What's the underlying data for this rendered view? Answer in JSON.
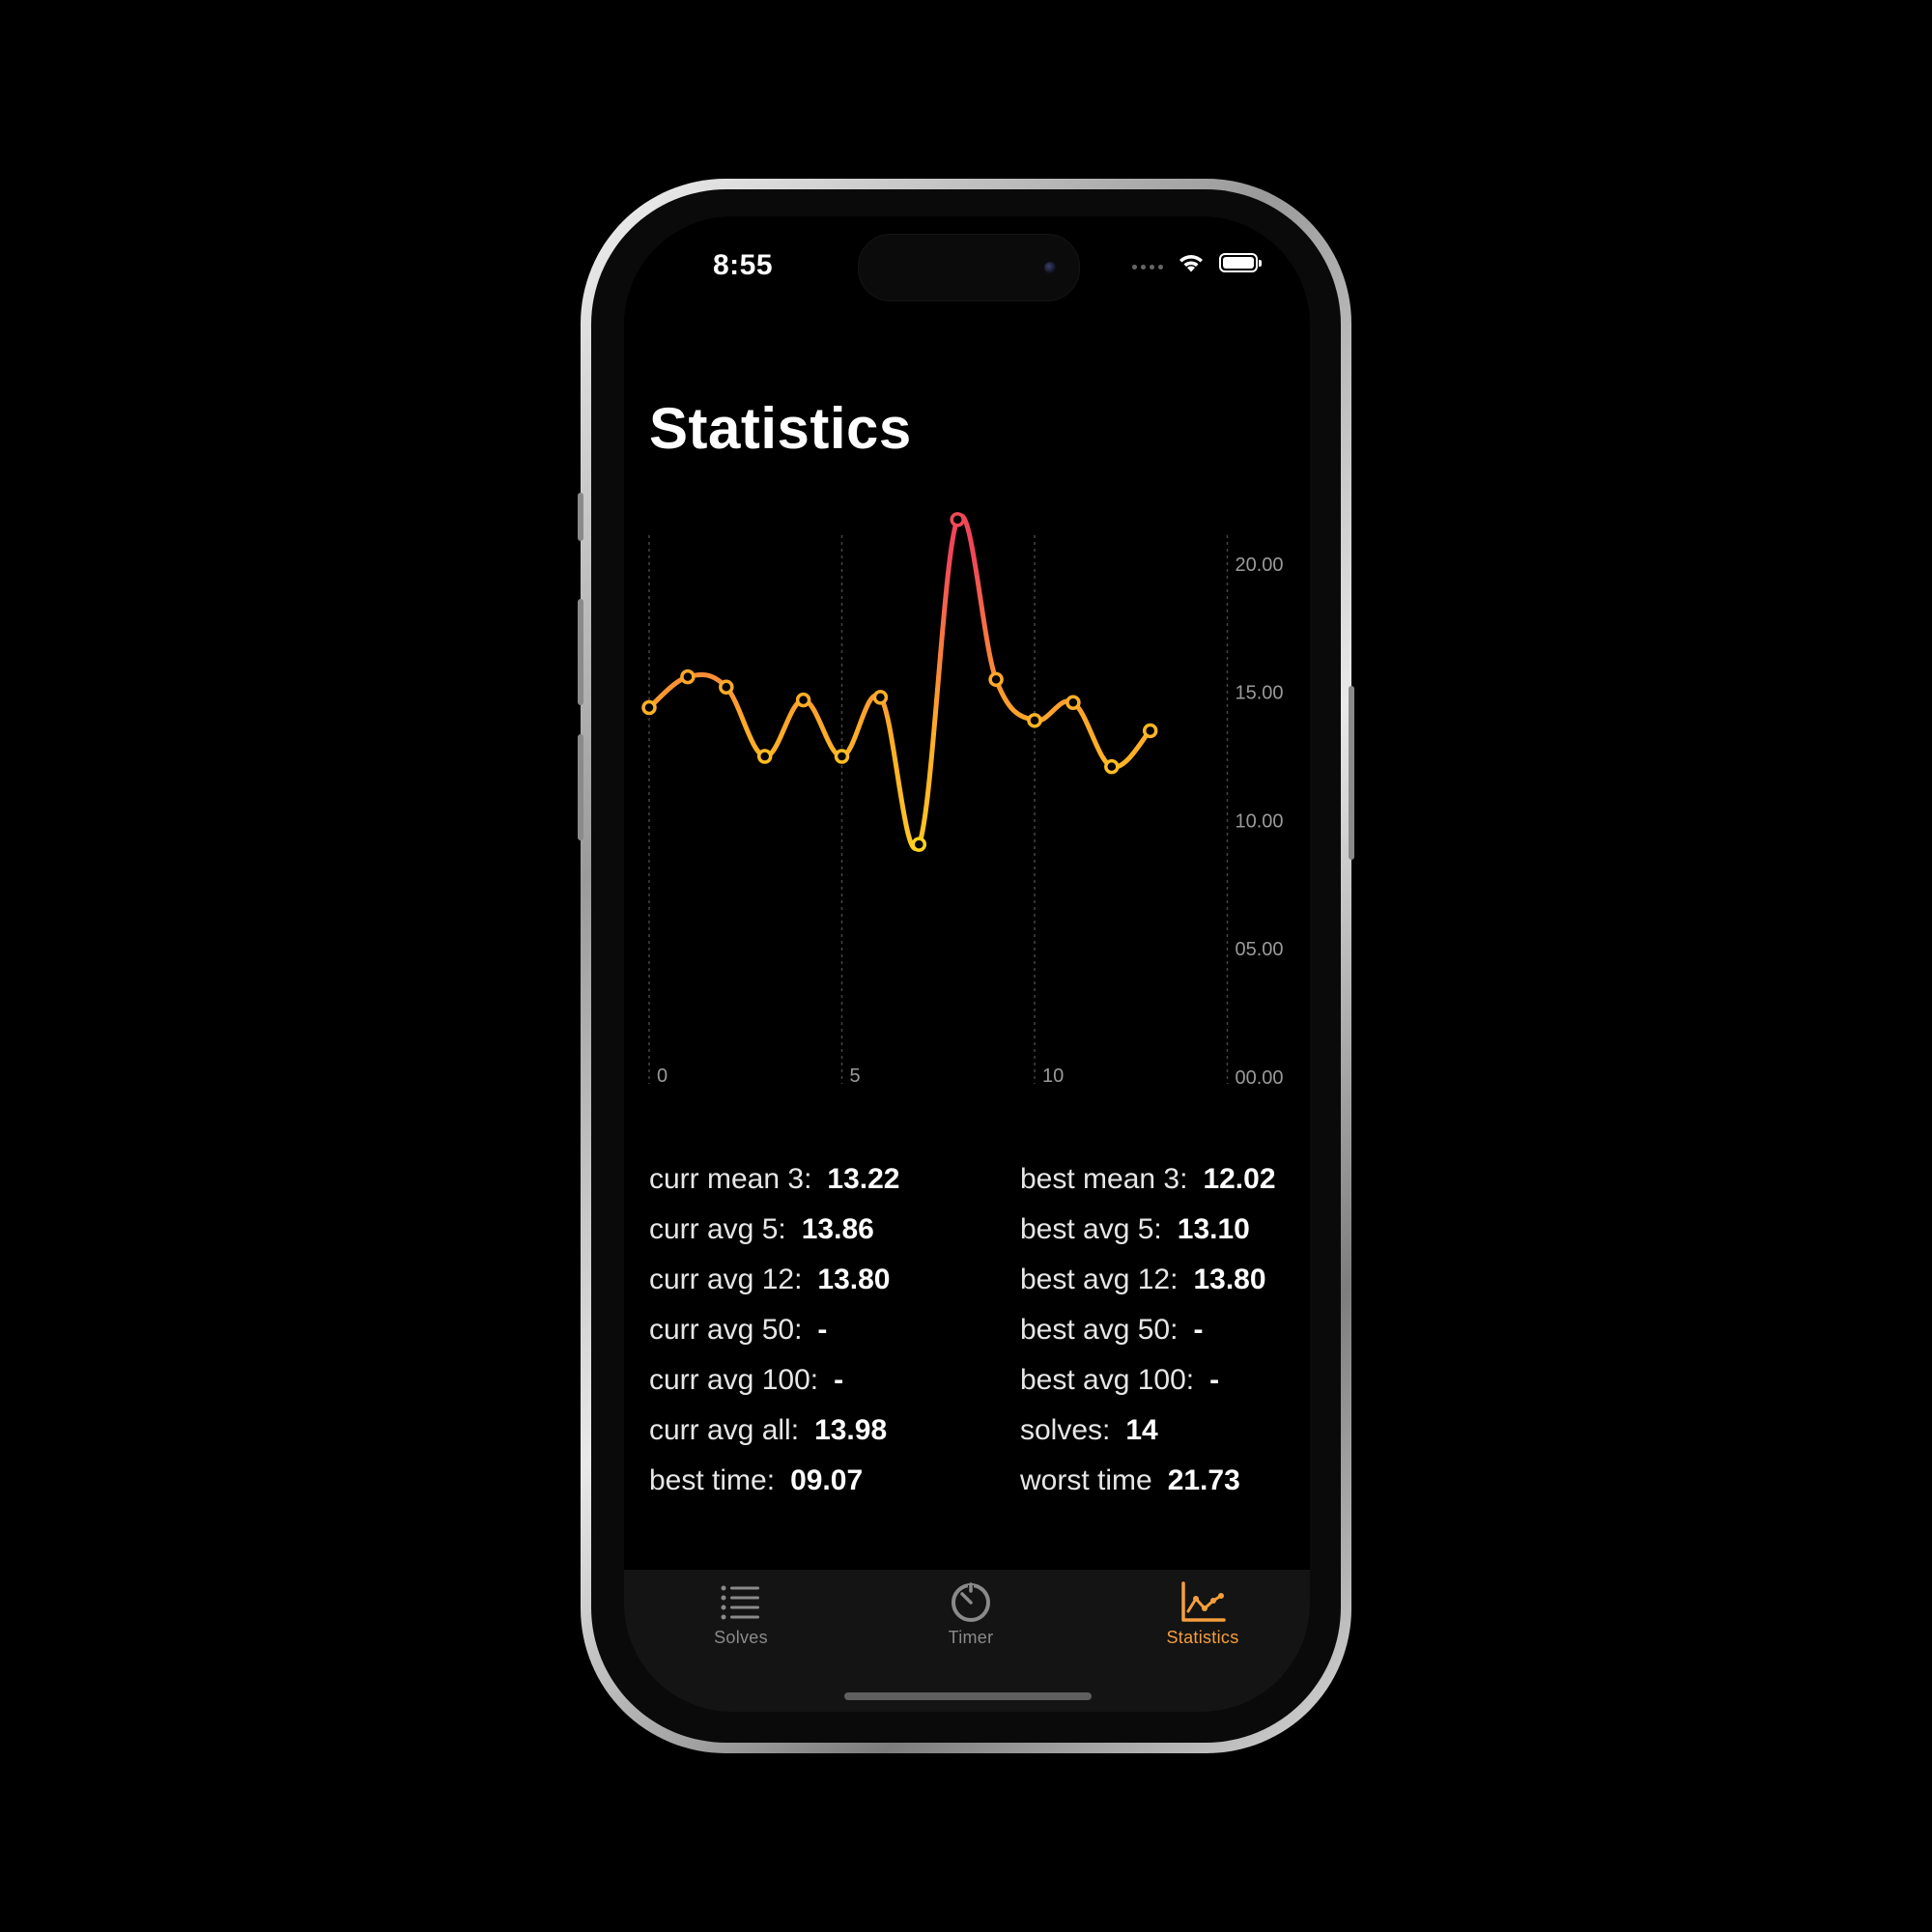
{
  "status_bar": {
    "time": "8:55"
  },
  "page_title": "Statistics",
  "colors": {
    "accent": "#F59E3D",
    "line_low": "#FFD21F",
    "line_mid": "#FFA928",
    "line_high": "#F0455A",
    "tab_inactive": "#8a8a8a"
  },
  "chart_data": {
    "type": "line",
    "x": [
      0,
      1,
      2,
      3,
      4,
      5,
      6,
      7,
      8,
      9,
      10,
      11,
      12,
      13
    ],
    "series": [
      {
        "values": [
          14.4,
          15.6,
          15.2,
          12.5,
          14.7,
          12.5,
          14.8,
          9.07,
          21.73,
          15.5,
          13.9,
          14.6,
          12.1,
          13.5
        ]
      }
    ],
    "xticks": [
      0,
      5,
      10
    ],
    "yticks": [
      0,
      5,
      10,
      15,
      20
    ],
    "ytick_labels": [
      "00.00",
      "05.00",
      "10.00",
      "15.00",
      "20.00"
    ],
    "xlim": [
      0,
      15
    ],
    "ylim": [
      0,
      23
    ],
    "grid": "vertical-dashed"
  },
  "stats": {
    "left": [
      {
        "label": "curr mean 3:",
        "value": "13.22"
      },
      {
        "label": "curr avg 5:",
        "value": "13.86"
      },
      {
        "label": "curr avg 12:",
        "value": "13.80"
      },
      {
        "label": "curr avg 50:",
        "value": "-"
      },
      {
        "label": "curr avg 100:",
        "value": "-"
      },
      {
        "label": "curr avg all:",
        "value": "13.98"
      },
      {
        "label": "best time:",
        "value": "09.07"
      }
    ],
    "right": [
      {
        "label": "best mean 3:",
        "value": "12.02"
      },
      {
        "label": "best avg 5:",
        "value": "13.10"
      },
      {
        "label": "best avg 12:",
        "value": "13.80"
      },
      {
        "label": "best avg 50:",
        "value": "-"
      },
      {
        "label": "best avg 100:",
        "value": "-"
      },
      {
        "label": "solves:",
        "value": "14"
      },
      {
        "label": "worst time",
        "value": "21.73"
      }
    ]
  },
  "tabs": [
    {
      "label": "Solves",
      "icon": "list-icon",
      "active": false
    },
    {
      "label": "Timer",
      "icon": "stopwatch-icon",
      "active": false
    },
    {
      "label": "Statistics",
      "icon": "chart-icon",
      "active": true
    }
  ]
}
